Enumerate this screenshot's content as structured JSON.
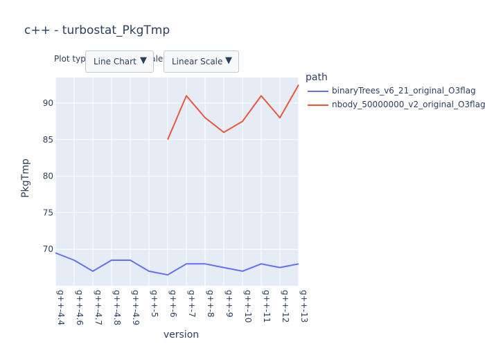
{
  "chart_data": {
    "type": "line",
    "title": "c++ - turbostat_PkgTmp",
    "xlabel": "version",
    "ylabel": "PkgTmp",
    "categories": [
      "g++-4.4",
      "g++-4.6",
      "g++-4.7",
      "g++-4.8",
      "g++-4.9",
      "g++-5",
      "g++-6",
      "g++-7",
      "g++-8",
      "g++-9",
      "g++-10",
      "g++-11",
      "g++-12",
      "g++-13"
    ],
    "ylim": [
      65,
      93.5
    ],
    "yticks": [
      70,
      75,
      80,
      85,
      90
    ],
    "grid": true,
    "legend_title": "path",
    "legend_position": "top-right",
    "series": [
      {
        "name": "binaryTrees_v6_21_original_O3flag",
        "color": "#636efa",
        "values": [
          69.5,
          68.5,
          67,
          68.5,
          68.5,
          67,
          66.5,
          68,
          68,
          67.5,
          67,
          68,
          67.5,
          68
        ]
      },
      {
        "name": "nbody_50000000_v2_original_O3flag",
        "color": "#ef553b",
        "values": [
          null,
          null,
          null,
          null,
          null,
          null,
          85,
          91,
          88,
          86,
          87.5,
          91,
          88,
          92.5
        ]
      }
    ]
  },
  "controls": {
    "plot_type_label": "Plot type",
    "plot_type_value": "Line Chart",
    "scale_label": "Scale:",
    "scale_value": "Linear Scale",
    "arrow": "▼"
  }
}
